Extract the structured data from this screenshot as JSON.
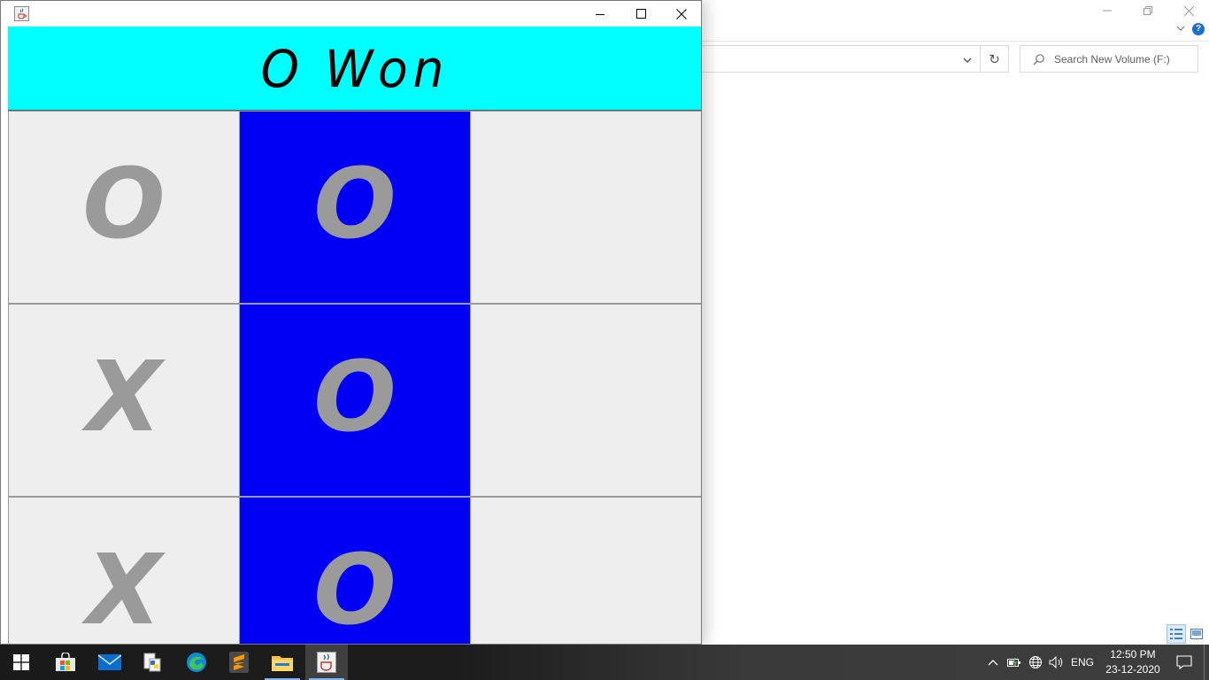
{
  "explorer": {
    "search_placeholder": "Search New Volume (F:)",
    "refresh_glyph": "↻"
  },
  "app": {
    "status_text": "O Won",
    "banner_color": "#00ffff",
    "win_color": "#0000f5",
    "cell_color": "#eeeeee",
    "mark_color": "#9a9a9a",
    "board": [
      {
        "mark": "O",
        "winning": false
      },
      {
        "mark": "O",
        "winning": true
      },
      {
        "mark": "",
        "winning": false
      },
      {
        "mark": "X",
        "winning": false
      },
      {
        "mark": "O",
        "winning": true
      },
      {
        "mark": "",
        "winning": false
      },
      {
        "mark": "X",
        "winning": false
      },
      {
        "mark": "O",
        "winning": true
      },
      {
        "mark": "",
        "winning": false
      }
    ]
  },
  "taskbar": {
    "apps": [
      "start-icon",
      "microsoft-store-icon",
      "mail-icon",
      "python-icon",
      "edge-icon",
      "sublime-text-icon",
      "file-explorer-icon",
      "java-app-icon"
    ],
    "tray": {
      "language": "ENG",
      "time": "12:50 PM",
      "date": "23-12-2020"
    }
  }
}
